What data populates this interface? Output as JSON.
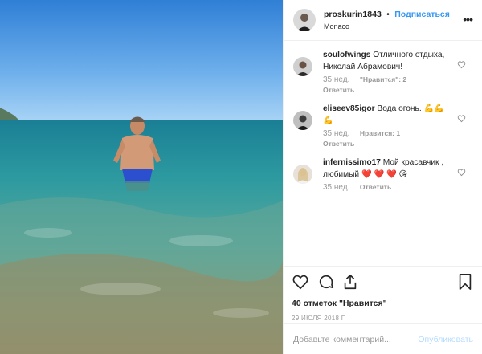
{
  "post": {
    "username": "proskurin1843",
    "separator": "•",
    "follow_label": "Подписаться",
    "location": "Monaco",
    "more_icon": "more-horizontal-icon"
  },
  "comments": [
    {
      "user": "soulofwings",
      "text": "Отличного отдыха, Николай Абрамович!",
      "time": "35 нед.",
      "likes": "\"Нравится\": 2",
      "reply": "Ответить"
    },
    {
      "user": "eliseev85igor",
      "text": "Вода огонь. 💪💪💪",
      "time": "35 нед.",
      "likes": "Нравится: 1",
      "reply": "Ответить"
    },
    {
      "user": "infernissimo17",
      "text": "Мой красавчик , любимый ❤️ ❤️ ❤️ 😘",
      "time": "35 нед.",
      "likes": "",
      "reply": "Ответить"
    }
  ],
  "actions": {
    "likes_count": "40 отметок \"Нравится\"",
    "date": "29 ИЮЛЯ 2018 Г."
  },
  "add_comment": {
    "placeholder": "Добавьте комментарий...",
    "post_label": "Опубликовать"
  },
  "colors": {
    "accent": "#3897f0",
    "muted": "#999999",
    "post_disabled": "#b3dbff"
  }
}
